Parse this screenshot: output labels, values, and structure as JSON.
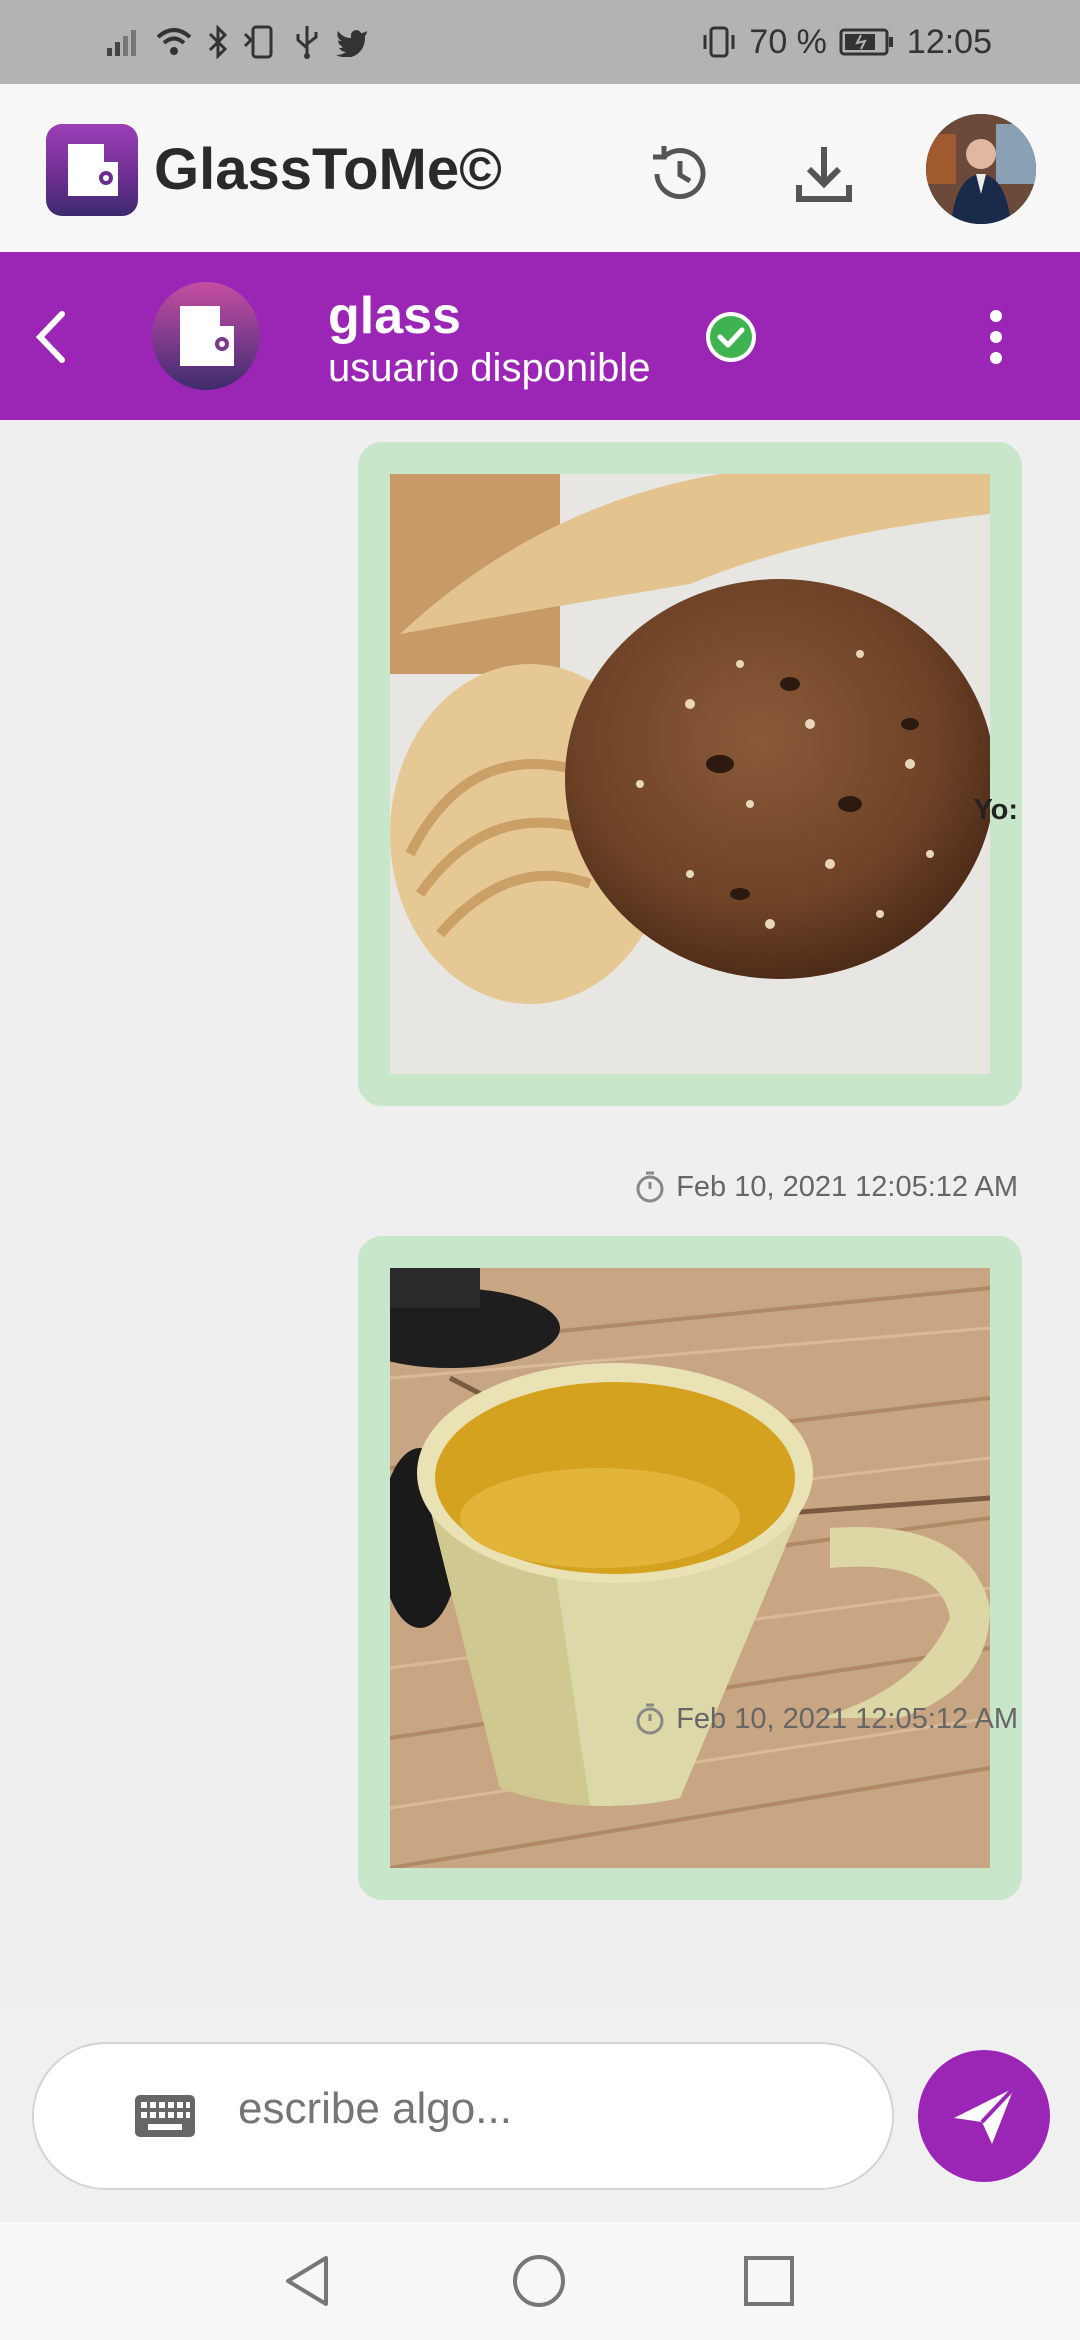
{
  "status_bar": {
    "battery_percent": "70 %",
    "time": "12:05"
  },
  "app_bar": {
    "title": "GlassToMe©"
  },
  "chat_header": {
    "contact_name": "glass",
    "contact_status": "usuario disponible"
  },
  "messages": [
    {
      "photo_icon": "cookies-photo",
      "timestamp": "Feb 10, 2021  12:05:12 AM"
    },
    {
      "sender": "Yo:",
      "photo_icon": "yellow-mug-photo",
      "timestamp": "Feb 10, 2021  12:05:12 AM"
    }
  ],
  "composer": {
    "placeholder": "escribe algo..."
  },
  "colors": {
    "primary": "#9b26b6",
    "bubble": "#c8e6c9",
    "online": "#3fb34f"
  }
}
